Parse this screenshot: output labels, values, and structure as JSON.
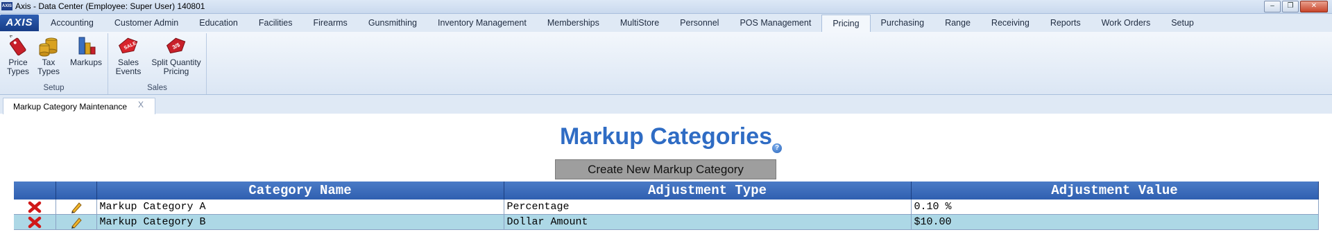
{
  "window": {
    "title": "Axis - Data Center  (Employee: Super User) 140801",
    "app_icon_text": "AXIS",
    "buttons": [
      "minimize",
      "restore",
      "close"
    ]
  },
  "ribbon": {
    "app_button": "AXIS",
    "tabs": [
      {
        "label": "Accounting"
      },
      {
        "label": "Customer Admin"
      },
      {
        "label": "Education"
      },
      {
        "label": "Facilities"
      },
      {
        "label": "Firearms"
      },
      {
        "label": "Gunsmithing"
      },
      {
        "label": "Inventory Management"
      },
      {
        "label": "Memberships"
      },
      {
        "label": "MultiStore"
      },
      {
        "label": "Personnel"
      },
      {
        "label": "POS Management"
      },
      {
        "label": "Pricing"
      },
      {
        "label": "Purchasing"
      },
      {
        "label": "Range"
      },
      {
        "label": "Receiving"
      },
      {
        "label": "Reports"
      },
      {
        "label": "Work Orders"
      },
      {
        "label": "Setup"
      }
    ],
    "active_tab": "Pricing",
    "groups": {
      "setup": {
        "label": "Setup",
        "price_types": {
          "line1": "Price",
          "line2": "Types"
        },
        "tax_types": {
          "line1": "Tax",
          "line2": "Types"
        },
        "markups": {
          "line1": "Markups"
        }
      },
      "sales": {
        "label": "Sales",
        "sales_events": {
          "line1": "Sales",
          "line2": "Events"
        },
        "split_quantity_pricing": {
          "line1": "Split Quantity",
          "line2": "Pricing"
        }
      }
    }
  },
  "doc_tab": {
    "label": "Markup Category Maintenance",
    "close": "X"
  },
  "main": {
    "title": "Markup Categories",
    "help": "?",
    "create_button": "Create New Markup Category",
    "table": {
      "headers": [
        "",
        "",
        "Category Name",
        "Adjustment Type",
        "Adjustment Value"
      ],
      "rows": [
        {
          "name": "Markup Category A",
          "type": "Percentage",
          "value": "0.10 %"
        },
        {
          "name": "Markup Category B",
          "type": "Dollar Amount",
          "value": "$10.00"
        }
      ]
    }
  },
  "colors": {
    "title_blue": "#2f6cc4",
    "header_blue": "#3d6ebd",
    "alt_row": "#add8e6",
    "button_gray": "#9e9e9e"
  }
}
